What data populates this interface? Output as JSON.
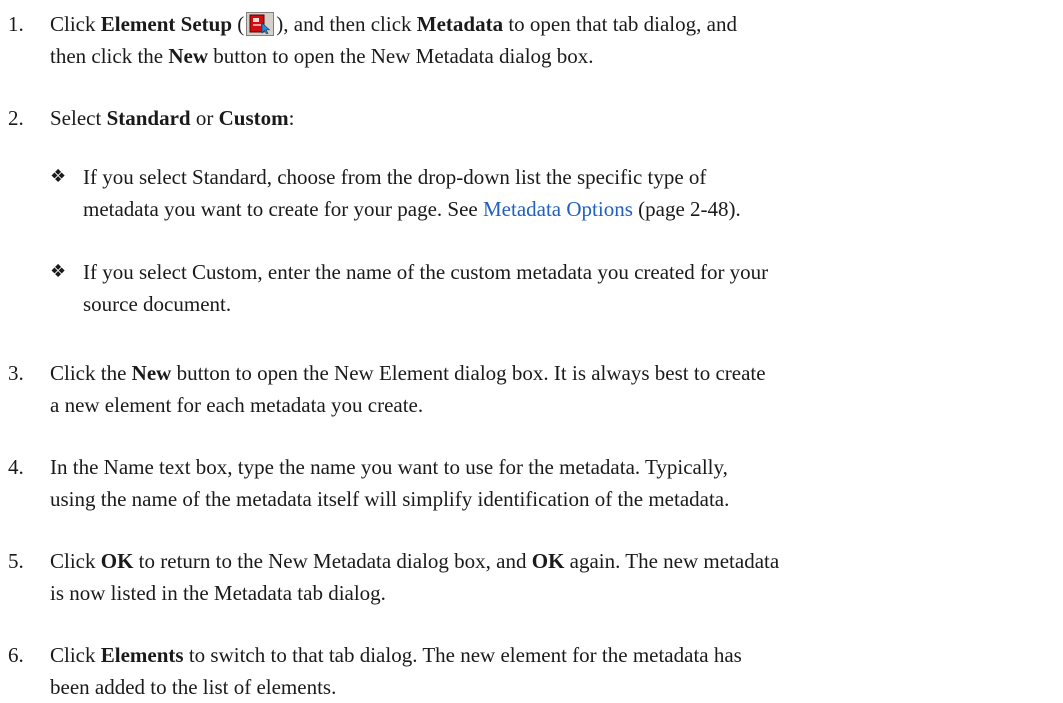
{
  "steps": [
    {
      "num": "1.",
      "parts": [
        "Click ",
        {
          "b": "Element Setup"
        },
        " (",
        {
          "icon": "element-setup-icon"
        },
        "), and then click ",
        {
          "b": "Metadata"
        },
        " to open that tab dialog, and then click the ",
        {
          "b": "New"
        },
        " button to open the New Metadata dialog box."
      ],
      "lines": [
        [
          "Click ",
          {
            "b": "Element Setup"
          },
          " (",
          {
            "icon": "element-setup-icon"
          },
          "), and then click ",
          {
            "b": "Metadata"
          },
          " to open that tab dialog, and"
        ],
        [
          "then click the ",
          {
            "b": "New"
          },
          " button to open the New Metadata dialog box."
        ]
      ]
    },
    {
      "num": "2.",
      "lines": [
        [
          "Select ",
          {
            "b": "Standard"
          },
          " or ",
          {
            "b": "Custom"
          },
          ":"
        ]
      ],
      "bullets": [
        {
          "mark": "❖",
          "lines": [
            [
              "If you select Standard, choose from the drop-down list the specific type of"
            ],
            [
              "metadata you want to create for your page. See ",
              {
                "link": "Metadata Options"
              },
              " (page 2-48)."
            ]
          ]
        },
        {
          "mark": "❖",
          "lines": [
            [
              "If you select Custom, enter the name of the custom metadata you created for your"
            ],
            [
              "source document."
            ]
          ]
        }
      ]
    },
    {
      "num": "3.",
      "lines": [
        [
          "Click the ",
          {
            "b": "New"
          },
          " button to open the New Element dialog box. It is always best to create"
        ],
        [
          "a new element for each metadata you create."
        ]
      ]
    },
    {
      "num": "4.",
      "lines": [
        [
          "In the Name text box, type the name you want to use for the metadata. Typically,"
        ],
        [
          "using the name of the metadata itself will simplify identification of the metadata."
        ]
      ]
    },
    {
      "num": "5.",
      "lines": [
        [
          "Click ",
          {
            "b": "OK"
          },
          " to return to the New Metadata dialog box, and ",
          {
            "b": "OK"
          },
          " again. The new metadata"
        ],
        [
          "is now listed in the Metadata tab dialog."
        ]
      ]
    },
    {
      "num": "6.",
      "lines": [
        [
          "Click ",
          {
            "b": "Elements"
          },
          " to switch to that tab dialog. The new element for the metadata has"
        ],
        [
          "been added to the list of elements."
        ]
      ]
    }
  ],
  "colors": {
    "link": "#1f5fbf",
    "text": "#1a1a1a"
  }
}
